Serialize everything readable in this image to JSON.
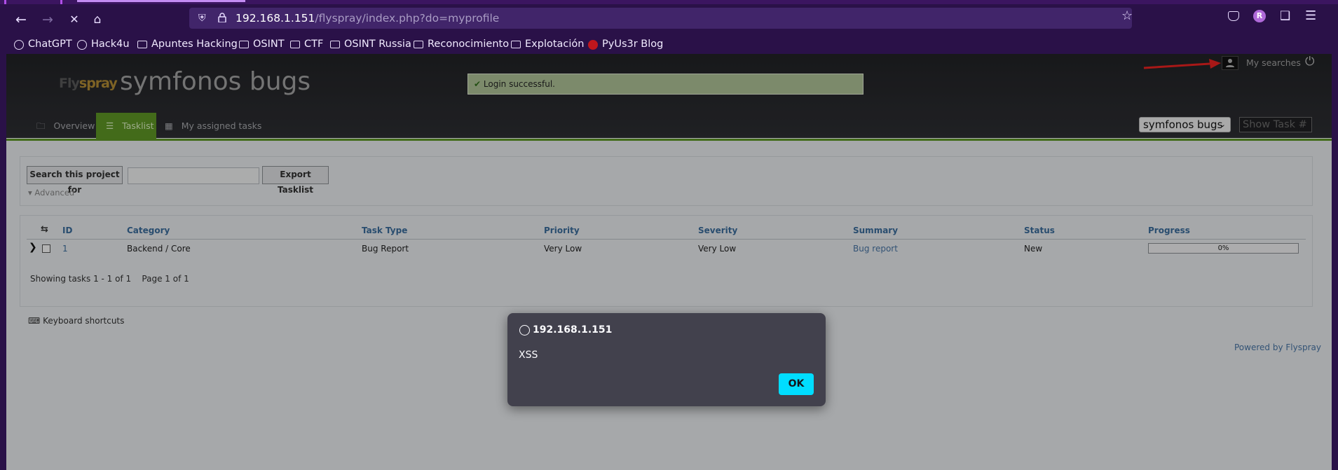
{
  "browser": {
    "url_host": "192.168.1.151",
    "url_path": "/flyspray/index.php?do=myprofile",
    "bookmarks": [
      "ChatGPT",
      "Hack4u",
      "Apuntes Hacking",
      "OSINT",
      "CTF",
      "OSINT Russia",
      "Reconocimiento",
      "Explotación",
      "PyUs3r Blog"
    ],
    "profile_initial": "R"
  },
  "header": {
    "logo_prefix": "Fly",
    "logo_suffix": "spray",
    "site_title": "symfonos bugs",
    "login_message": "Login successful.",
    "my_searches": "My searches",
    "tabs": [
      "Overview",
      "Tasklist",
      "My assigned tasks"
    ],
    "project_select": "symfonos bugs",
    "show_task_placeholder": "Show Task #"
  },
  "search": {
    "search_button": "Search this project for",
    "export_button": "Export Tasklist",
    "advanced": "▾ Advanced"
  },
  "table": {
    "columns": [
      "ID",
      "Category",
      "Task Type",
      "Priority",
      "Severity",
      "Summary",
      "Status",
      "Progress"
    ],
    "rows": [
      {
        "id": "1",
        "category": "Backend / Core",
        "task_type": "Bug Report",
        "priority": "Very Low",
        "severity": "Very Low",
        "summary": "Bug report",
        "status": "New",
        "progress": "0%"
      }
    ],
    "showing": "Showing tasks 1 - 1 of 1",
    "page": "Page 1 of 1"
  },
  "footer": {
    "keyboard_shortcuts": "Keyboard shortcuts",
    "powered_by": "Powered by Flyspray"
  },
  "alert": {
    "host": "192.168.1.151",
    "message": "XSS",
    "ok_label": "OK"
  },
  "colors": {
    "accent_green": "#5a8f23",
    "alert_ok": "#00ddff",
    "browser_purple": "#2a1148"
  }
}
